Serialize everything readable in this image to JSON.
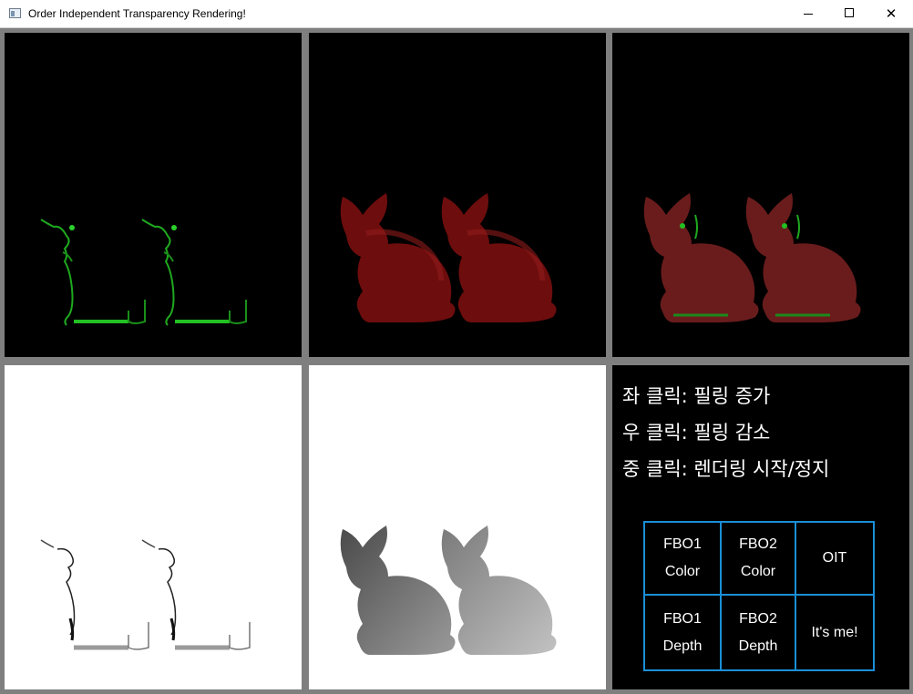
{
  "window": {
    "title": "Order Independent Transparency Rendering!",
    "minimize_glyph": "—",
    "maximize_glyph": "☐",
    "close_glyph": "✕"
  },
  "panels": [
    {
      "name": "fbo1-color",
      "background": "#000000",
      "figure_color": "green-edges"
    },
    {
      "name": "fbo2-color",
      "background": "#000000",
      "figure_color": "#8a0f0f"
    },
    {
      "name": "oit",
      "background": "#000000",
      "figure_color": "#7a1f1f"
    },
    {
      "name": "fbo1-depth",
      "background": "#ffffff",
      "figure_color": "white-with-gray-edges"
    },
    {
      "name": "fbo2-depth",
      "background": "#ffffff",
      "figure_color": "gray-gradient"
    }
  ],
  "info": {
    "line1": "좌 클릭: 필링 증가",
    "line2": "우 클릭: 필링 감소",
    "line3": "중 클릭: 렌더링 시작/정지"
  },
  "legend": {
    "border_color": "#1a8fd8",
    "cells": [
      {
        "line1": "FBO1",
        "line2": "Color"
      },
      {
        "line1": "FBO2",
        "line2": "Color"
      },
      {
        "line1": "OIT",
        "line2": ""
      },
      {
        "line1": "FBO1",
        "line2": "Depth"
      },
      {
        "line1": "FBO2",
        "line2": "Depth"
      },
      {
        "line1": "It's me!",
        "line2": ""
      }
    ]
  }
}
